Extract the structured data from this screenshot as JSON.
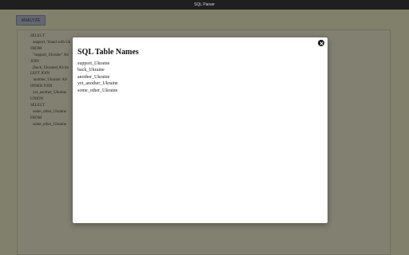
{
  "window": {
    "title": "SQL Parser"
  },
  "toolbar": {
    "analyze_label": "ANALYZE"
  },
  "editor": {
    "lines": [
      {
        "text": "SELECT",
        "indent": false
      },
      {
        "text": "support, 'Stand with Uk",
        "indent": true
      },
      {
        "text": "FROM",
        "indent": false
      },
      {
        "text": "\"support_Ukraine\" AS",
        "indent": true
      },
      {
        "text": "JOIN",
        "indent": false
      },
      {
        "text": "[back_Ukraine] AS ba",
        "indent": true
      },
      {
        "text": "LEFT JOIN",
        "indent": false
      },
      {
        "text": "'another_Ukraine' AS",
        "indent": true
      },
      {
        "text": "INNER JOIN",
        "indent": false
      },
      {
        "text": "yet_another_Ukraine",
        "indent": true
      },
      {
        "text": "UNION",
        "indent": false
      },
      {
        "text": "SELECT",
        "indent": false
      },
      {
        "text": "some_other_Ukraine",
        "indent": true
      },
      {
        "text": "FROM",
        "indent": false
      },
      {
        "text": "some_other_Ukraine",
        "indent": true
      }
    ]
  },
  "modal": {
    "title": "SQL Table Names",
    "close_icon": "close-icon",
    "tables": [
      "support_Ukraine",
      "back_Ukraine",
      "another_Ukraine",
      "yet_another_Ukraine",
      "some_other_Ukraine"
    ]
  },
  "colors": {
    "app_background": "#ebe9c4",
    "button_background": "#b7bcd0",
    "titlebar": "#1f1f1f",
    "overlay": "rgba(0,0,0,0.45)"
  }
}
